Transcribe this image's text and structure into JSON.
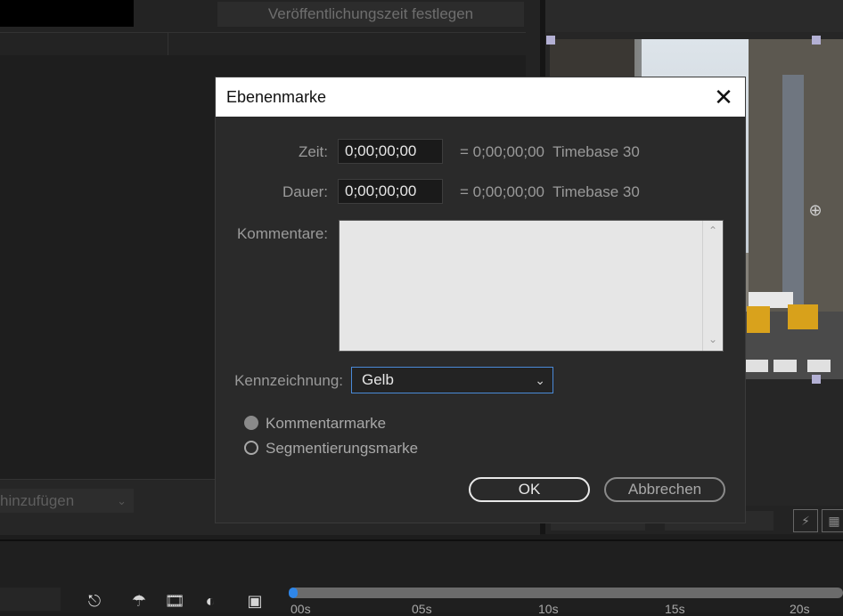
{
  "background": {
    "publish_button_label": "Veröffentlichungszeit festlegen",
    "add_dropdown_label": "hinzufügen",
    "timeline_ticks": [
      "00s",
      "05s",
      "10s",
      "15s",
      "20s"
    ]
  },
  "dialog": {
    "title": "Ebenenmarke",
    "time_label": "Zeit:",
    "time_value": "0;00;00;00",
    "time_equivalent": "= 0;00;00;00  Timebase 30",
    "duration_label": "Dauer:",
    "duration_value": "0;00;00;00",
    "duration_equivalent": "= 0;00;00;00  Timebase 30",
    "comments_label": "Kommentare:",
    "comments_value": "",
    "label_label": "Kennzeichnung:",
    "label_selected": "Gelb",
    "radio_comment": "Kommentarmarke",
    "radio_segment": "Segmentierungsmarke",
    "ok_label": "OK",
    "cancel_label": "Abbrechen"
  },
  "icons": {
    "close": "close-icon",
    "dropdown": "chevron-down-icon",
    "scroll_up": "chevron-up-icon",
    "scroll_down": "chevron-down-icon"
  },
  "colors": {
    "dialog_bg": "#2a2a2a",
    "titlebar_bg": "#ffffff",
    "focus_border": "#4a8ad8",
    "playhead": "#2f86e8"
  }
}
